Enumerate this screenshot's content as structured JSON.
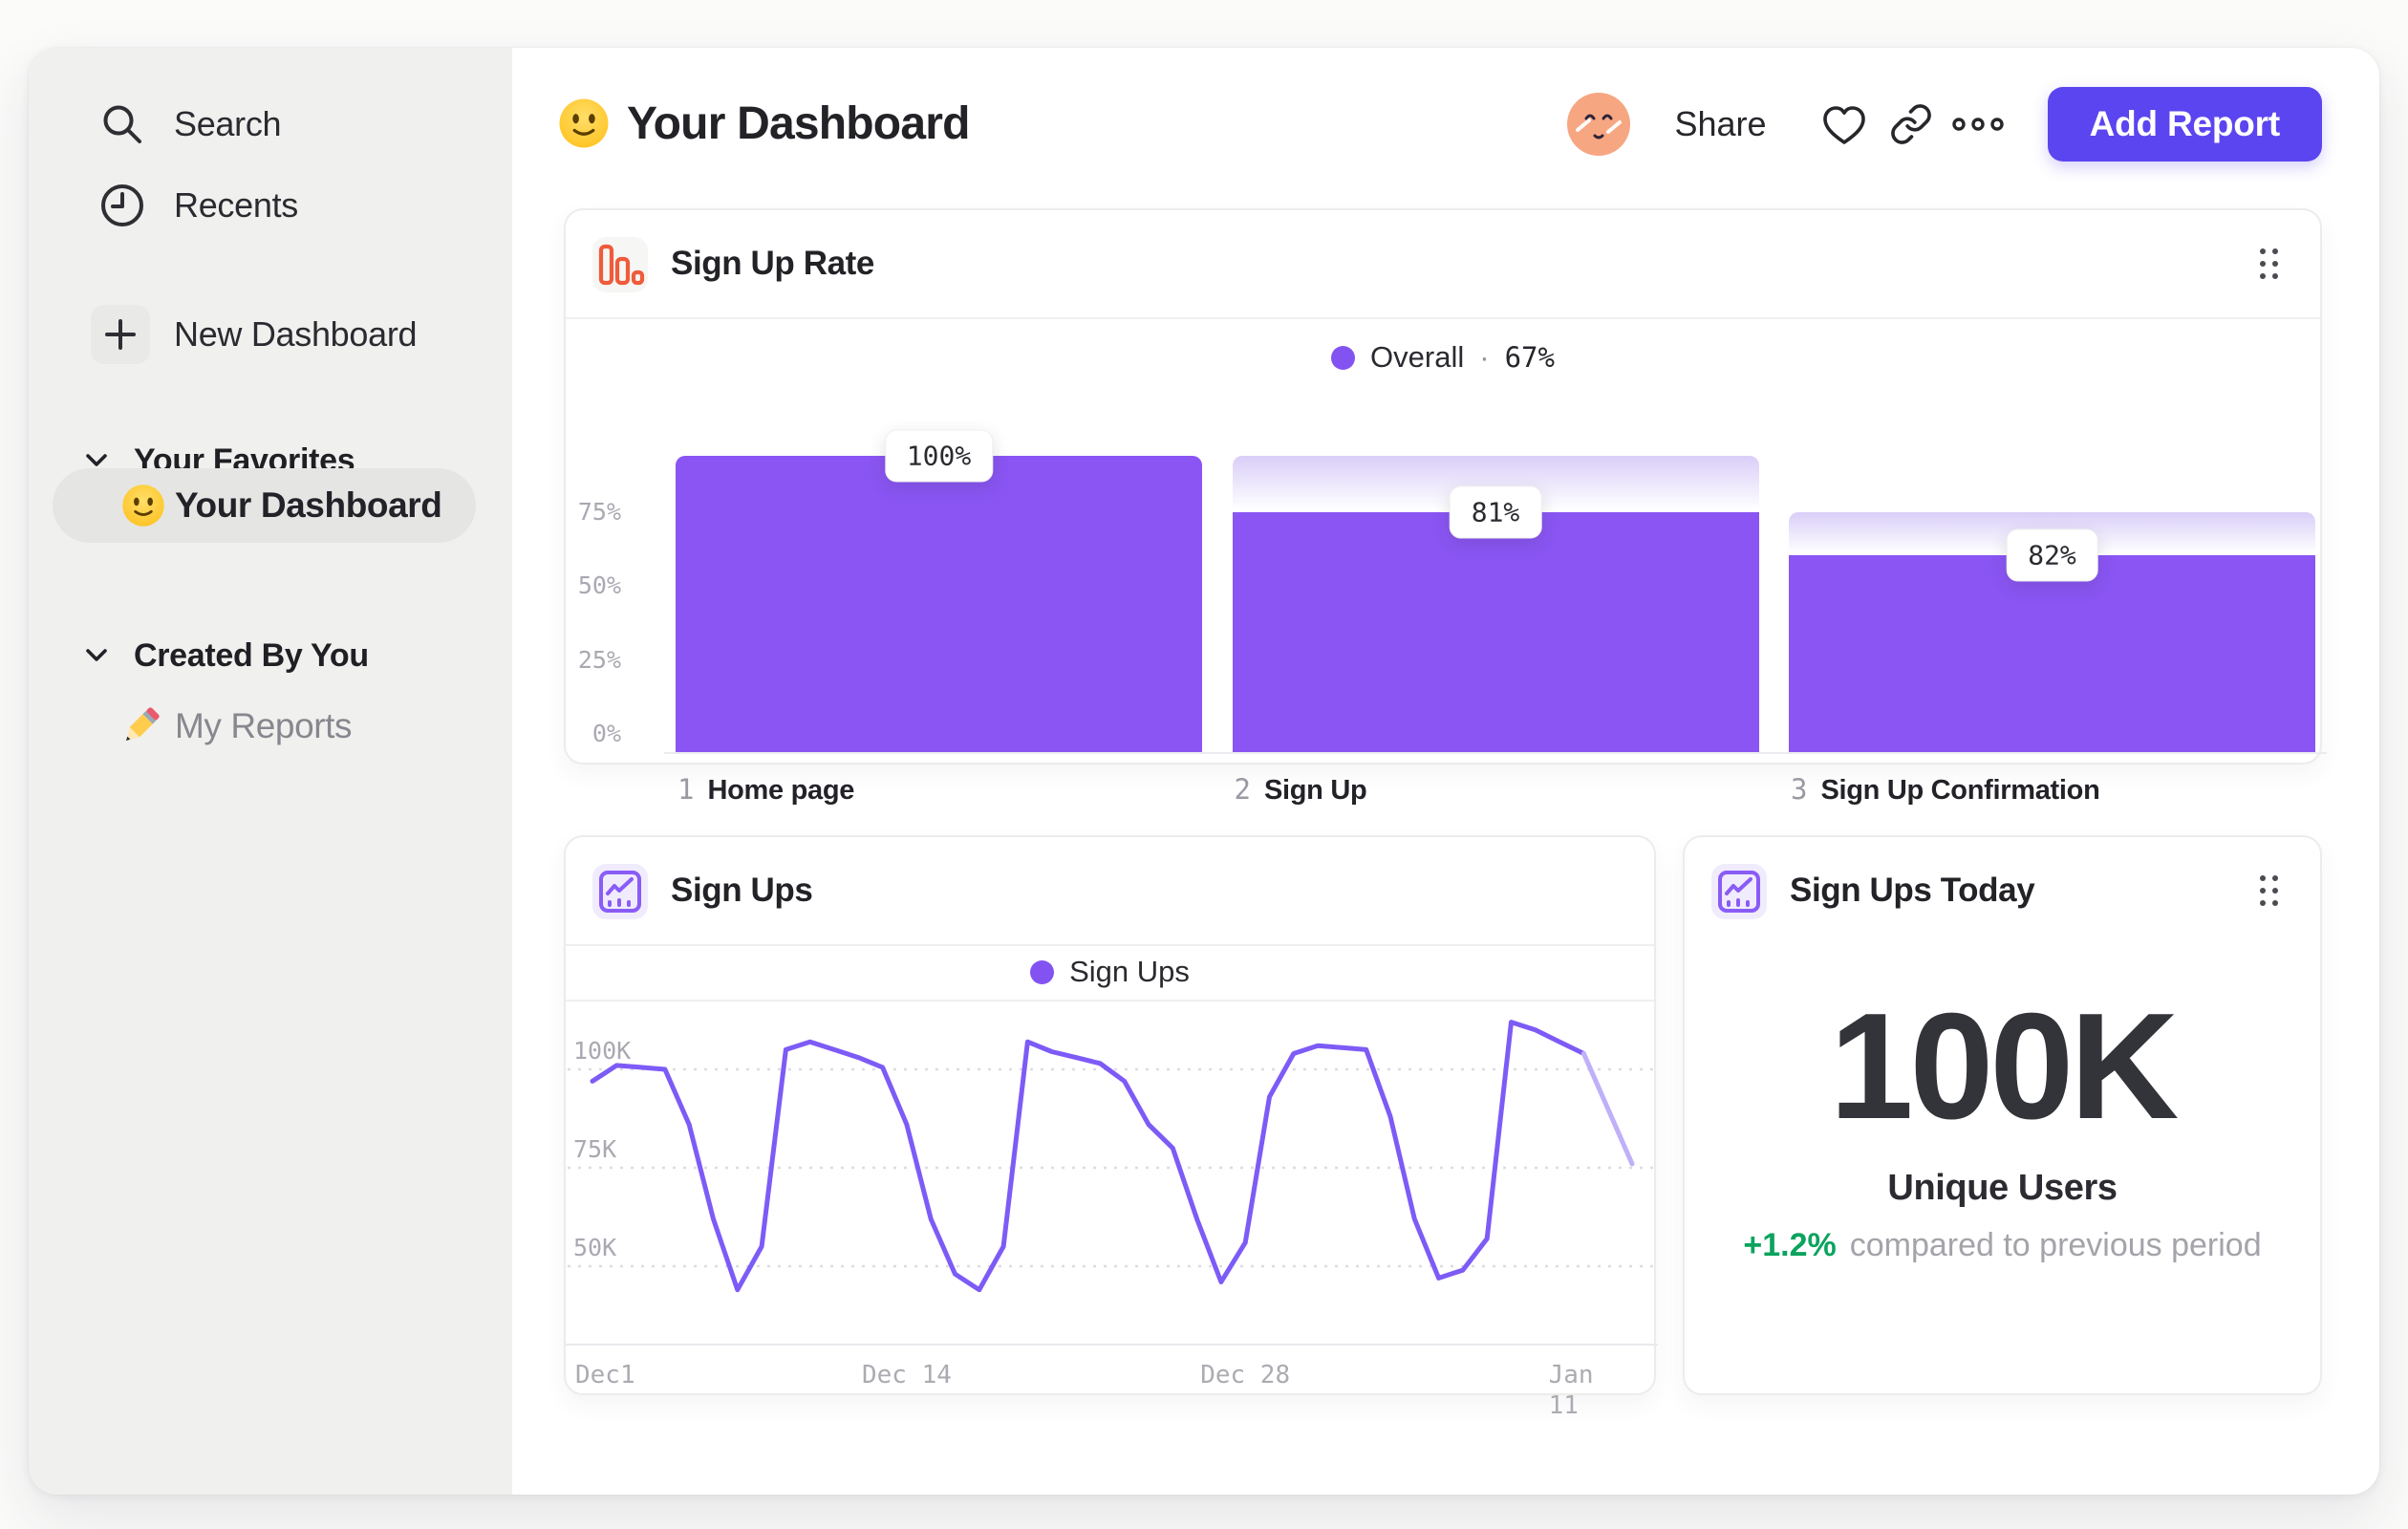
{
  "header": {
    "title": "Your Dashboard",
    "share": "Share",
    "add_report": "Add Report"
  },
  "sidebar": {
    "nav": [
      {
        "label": "Search",
        "icon": "search-icon"
      },
      {
        "label": "Recents",
        "icon": "clock-icon"
      },
      {
        "label": "New Dashboard",
        "icon": "plus-icon"
      }
    ],
    "sections": [
      {
        "label": "Your Favorites",
        "items": [
          {
            "label": "Your Dashboard",
            "icon": "smiley-emoji",
            "selected": true
          }
        ]
      },
      {
        "label": "Created By You",
        "items": [
          {
            "label": "My Reports",
            "icon": "pencil-emoji",
            "selected": false
          }
        ]
      }
    ]
  },
  "chart_data": [
    {
      "type": "bar",
      "title": "Sign Up Rate",
      "legend_label": "Overall",
      "legend_separator": "·",
      "legend_value": "67%",
      "categories": [
        "Home page",
        "Sign Up",
        "Sign Up Confirmation"
      ],
      "step_numbers": [
        "1",
        "2",
        "3"
      ],
      "step_conversion_pct": [
        100,
        81,
        82
      ],
      "absolute_pct": [
        100,
        81,
        66.4
      ],
      "bar_labels": [
        "100%",
        "81%",
        "82%"
      ],
      "y_ticks": [
        {
          "label": "75%",
          "value": 75
        },
        {
          "label": "50%",
          "value": 50
        },
        {
          "label": "25%",
          "value": 25
        },
        {
          "label": "0%",
          "value": 0
        }
      ],
      "ylim": [
        0,
        100
      ],
      "grid": false,
      "legend_position": "top-center"
    },
    {
      "type": "line",
      "title": "Sign Ups",
      "legend_label": "Sign Ups",
      "x_unit": "day index from Dec 1",
      "values_k": [
        97,
        101,
        100.5,
        100,
        86,
        62,
        44,
        55,
        105,
        107,
        105,
        103,
        100.5,
        86,
        62,
        48,
        44,
        55,
        107,
        104.5,
        103,
        101.5,
        97,
        86,
        80,
        62,
        46,
        56,
        93,
        104,
        106,
        105.5,
        105,
        88,
        62,
        47,
        49,
        57,
        112,
        110,
        107,
        104,
        90,
        76
      ],
      "faded_tail_segments": 2,
      "x_ticks": [
        {
          "label": "Dec1",
          "day": 0
        },
        {
          "label": "Dec 14",
          "day": 13
        },
        {
          "label": "Dec 28",
          "day": 27
        },
        {
          "label": "Jan 11",
          "day": 41
        }
      ],
      "y_ticks": [
        {
          "label": "100K",
          "value": 100
        },
        {
          "label": "75K",
          "value": 75
        },
        {
          "label": "50K",
          "value": 50
        }
      ],
      "ylim_k": [
        38,
        116
      ],
      "grid": "dotted-horizontal",
      "legend_position": "top-center"
    },
    {
      "type": "metric",
      "title": "Sign Ups Today",
      "value": "100K",
      "label": "Unique Users",
      "delta_pct": "+1.2%",
      "delta_note": "compared to previous period"
    }
  ],
  "colors": {
    "page-bg": "#FBFBFA",
    "sidebar-bg": "#F0F0EE",
    "pill-bg": "#E5E5E3",
    "card-border": "#ECECEA",
    "divider": "#EFEFED",
    "bar-purple": "#8A55F3",
    "line-purple": "#7D5BF6",
    "line-fade": "#BFB0F9",
    "dot-purple": "#8353F2",
    "btn-indigo": "#5B45F0",
    "coral": "#EE5C3C",
    "icon-purple": "#8A5CF6",
    "green": "#0CA35E",
    "grid-dot": "#DCDCE2",
    "axis-line": "#E9E9ED"
  }
}
